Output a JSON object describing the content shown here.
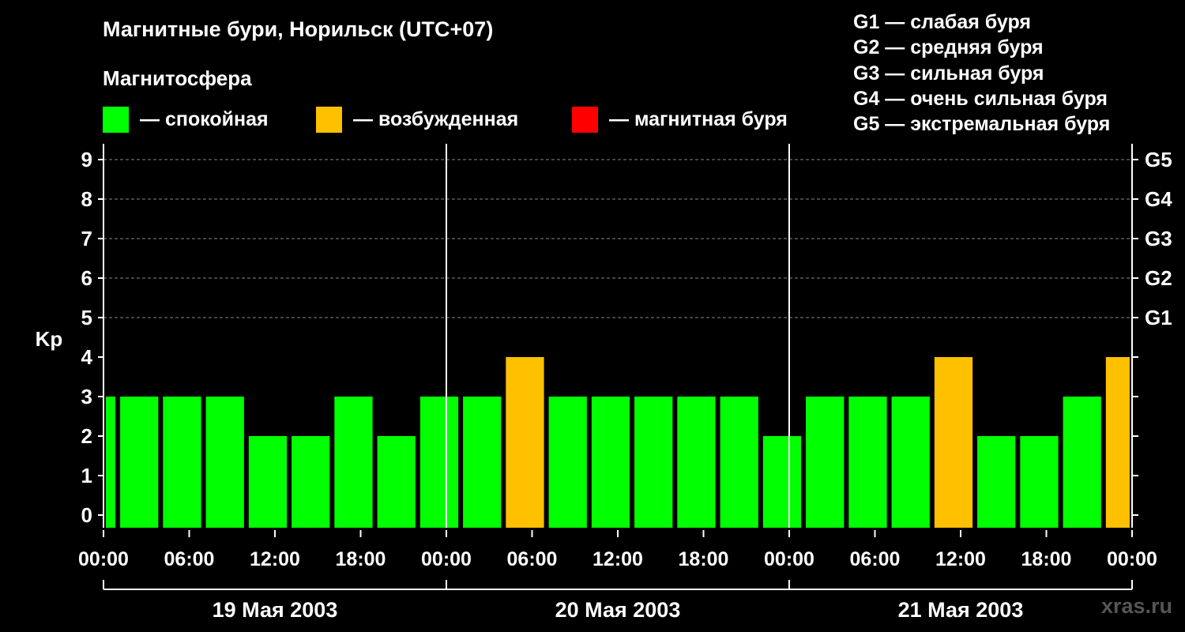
{
  "header": {
    "title": "Магнитные бури, Норильск (UTC+07)",
    "subtitle": "Магнитосфера"
  },
  "legend": {
    "items": [
      {
        "label": "— спокойная",
        "color": "#00ff00"
      },
      {
        "label": "— возбужденная",
        "color": "#ffc000"
      },
      {
        "label": "— магнитная буря",
        "color": "#ff0000"
      }
    ],
    "storm_levels": [
      "G1 — слабая буря",
      "G2 — средняя буря",
      "G3 — сильная буря",
      "G4 — очень сильная буря",
      "G5 — экстремальная буря"
    ]
  },
  "footer": {
    "watermark": "xras.ru"
  },
  "chart_data": {
    "type": "bar",
    "ylabel": "Kp",
    "ylim": [
      0,
      9
    ],
    "yticks": [
      "0",
      "1",
      "2",
      "3",
      "4",
      "5",
      "6",
      "7",
      "8",
      "9"
    ],
    "right_ticks": [
      {
        "value": 5,
        "label": "G1"
      },
      {
        "value": 6,
        "label": "G2"
      },
      {
        "value": 7,
        "label": "G3"
      },
      {
        "value": 8,
        "label": "G4"
      },
      {
        "value": 9,
        "label": "G5"
      }
    ],
    "xticks": [
      "00:00",
      "06:00",
      "12:00",
      "18:00",
      "00:00",
      "06:00",
      "12:00",
      "18:00",
      "00:00",
      "06:00",
      "12:00",
      "18:00",
      "00:00"
    ],
    "days": [
      "19 Мая 2003",
      "20 Мая 2003",
      "21 Мая 2003"
    ],
    "xlim_hours": [
      0,
      72
    ],
    "grid": "dashed horizontal",
    "colors": {
      "quiet": "#00ff00",
      "active": "#ffc000",
      "storm": "#ff0000"
    },
    "bars": [
      {
        "start": 0,
        "end": 1,
        "kp": 3
      },
      {
        "start": 1,
        "end": 4,
        "kp": 3
      },
      {
        "start": 4,
        "end": 7,
        "kp": 3
      },
      {
        "start": 7,
        "end": 10,
        "kp": 3
      },
      {
        "start": 10,
        "end": 13,
        "kp": 2
      },
      {
        "start": 13,
        "end": 16,
        "kp": 2
      },
      {
        "start": 16,
        "end": 19,
        "kp": 3
      },
      {
        "start": 19,
        "end": 22,
        "kp": 2
      },
      {
        "start": 22,
        "end": 25,
        "kp": 3
      },
      {
        "start": 25,
        "end": 28,
        "kp": 3
      },
      {
        "start": 28,
        "end": 31,
        "kp": 4
      },
      {
        "start": 31,
        "end": 34,
        "kp": 3
      },
      {
        "start": 34,
        "end": 37,
        "kp": 3
      },
      {
        "start": 37,
        "end": 40,
        "kp": 3
      },
      {
        "start": 40,
        "end": 43,
        "kp": 3
      },
      {
        "start": 43,
        "end": 46,
        "kp": 3
      },
      {
        "start": 46,
        "end": 49,
        "kp": 2
      },
      {
        "start": 49,
        "end": 52,
        "kp": 3
      },
      {
        "start": 52,
        "end": 55,
        "kp": 3
      },
      {
        "start": 55,
        "end": 58,
        "kp": 3
      },
      {
        "start": 58,
        "end": 61,
        "kp": 4
      },
      {
        "start": 61,
        "end": 64,
        "kp": 2
      },
      {
        "start": 64,
        "end": 67,
        "kp": 2
      },
      {
        "start": 67,
        "end": 70,
        "kp": 3
      },
      {
        "start": 70,
        "end": 72,
        "kp": 4
      }
    ]
  }
}
